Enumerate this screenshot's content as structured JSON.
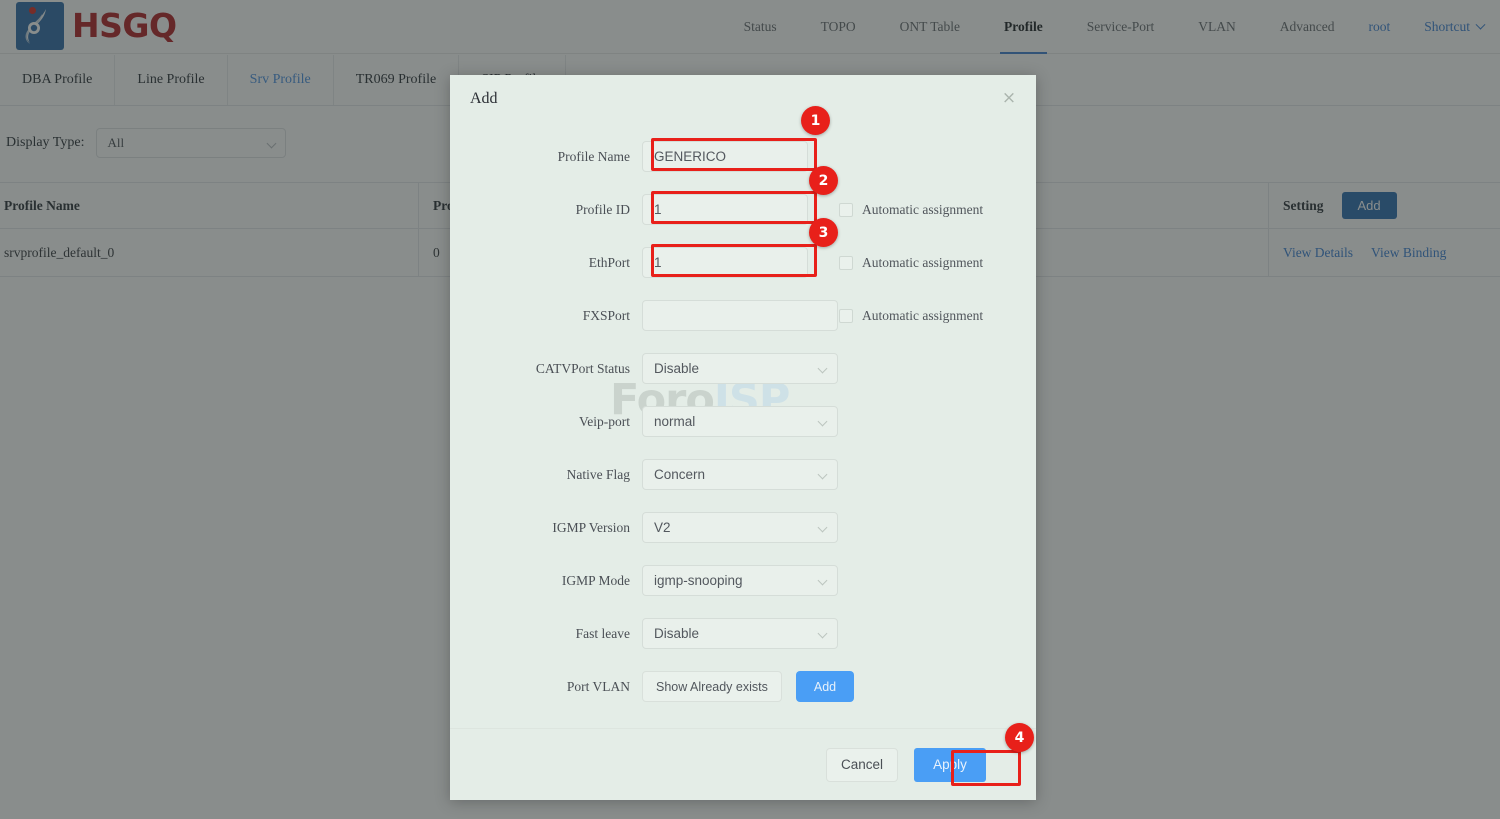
{
  "header": {
    "logo_text": "HSGQ",
    "nav": [
      {
        "label": "Status",
        "active": false
      },
      {
        "label": "TOPO",
        "active": false
      },
      {
        "label": "ONT Table",
        "active": false
      },
      {
        "label": "Profile",
        "active": true
      },
      {
        "label": "Service-Port",
        "active": false
      },
      {
        "label": "VLAN",
        "active": false
      },
      {
        "label": "Advanced",
        "active": false
      }
    ],
    "user": "root",
    "shortcut": "Shortcut"
  },
  "tabs": [
    {
      "label": "DBA Profile",
      "active": false
    },
    {
      "label": "Line Profile",
      "active": false
    },
    {
      "label": "Srv Profile",
      "active": true
    },
    {
      "label": "TR069 Profile",
      "active": false
    },
    {
      "label": "SIP Profile",
      "active": false
    }
  ],
  "filter": {
    "label": "Display Type:",
    "value": "All"
  },
  "table": {
    "columns": [
      "Profile Name",
      "Profile ID",
      "Setting"
    ],
    "add_button": "Add",
    "rows": [
      {
        "profile_name": "srvprofile_default_0",
        "profile_id": "0",
        "actions": [
          "View Details",
          "View Binding"
        ]
      }
    ]
  },
  "watermark": {
    "part1": "Foro",
    "part2": "ISP"
  },
  "modal": {
    "title": "Add",
    "close_icon": "×",
    "fields": [
      {
        "label": "Profile Name",
        "value": "GENERICO",
        "type": "input",
        "checkbox": null
      },
      {
        "label": "Profile ID",
        "value": "1",
        "type": "input",
        "checkbox": "Automatic assignment"
      },
      {
        "label": "EthPort",
        "value": "1",
        "type": "input",
        "checkbox": "Automatic assignment"
      },
      {
        "label": "FXSPort",
        "value": "",
        "type": "input",
        "checkbox": "Automatic assignment"
      },
      {
        "label": "CATVPort Status",
        "value": "Disable",
        "type": "select",
        "checkbox": null
      },
      {
        "label": "Veip-port",
        "value": "normal",
        "type": "select",
        "checkbox": null
      },
      {
        "label": "Native Flag",
        "value": "Concern",
        "type": "select",
        "checkbox": null
      },
      {
        "label": "IGMP Version",
        "value": "V2",
        "type": "select",
        "checkbox": null
      },
      {
        "label": "IGMP Mode",
        "value": "igmp-snooping",
        "type": "select",
        "checkbox": null
      },
      {
        "label": "Fast leave",
        "value": "Disable",
        "type": "select",
        "checkbox": null
      }
    ],
    "port_vlan": {
      "label": "Port VLAN",
      "show_button": "Show Already exists",
      "add_button": "Add"
    },
    "footer": {
      "cancel": "Cancel",
      "apply": "Apply"
    }
  },
  "annotations": {
    "accent_color": "#e8201a",
    "markers": [
      {
        "number": "1",
        "target": "profile-name-input"
      },
      {
        "number": "2",
        "target": "profile-id-input"
      },
      {
        "number": "3",
        "target": "ethport-input"
      },
      {
        "number": "4",
        "target": "apply-button"
      }
    ]
  },
  "colors": {
    "brand_red": "#b01f24",
    "logo_blue": "#2f6ca8",
    "link_blue": "#3b7fd4",
    "primary_blue": "#4a9ef5",
    "modal_bg": "#e4ede7",
    "overlay": "rgba(40,48,45,0.55)"
  }
}
